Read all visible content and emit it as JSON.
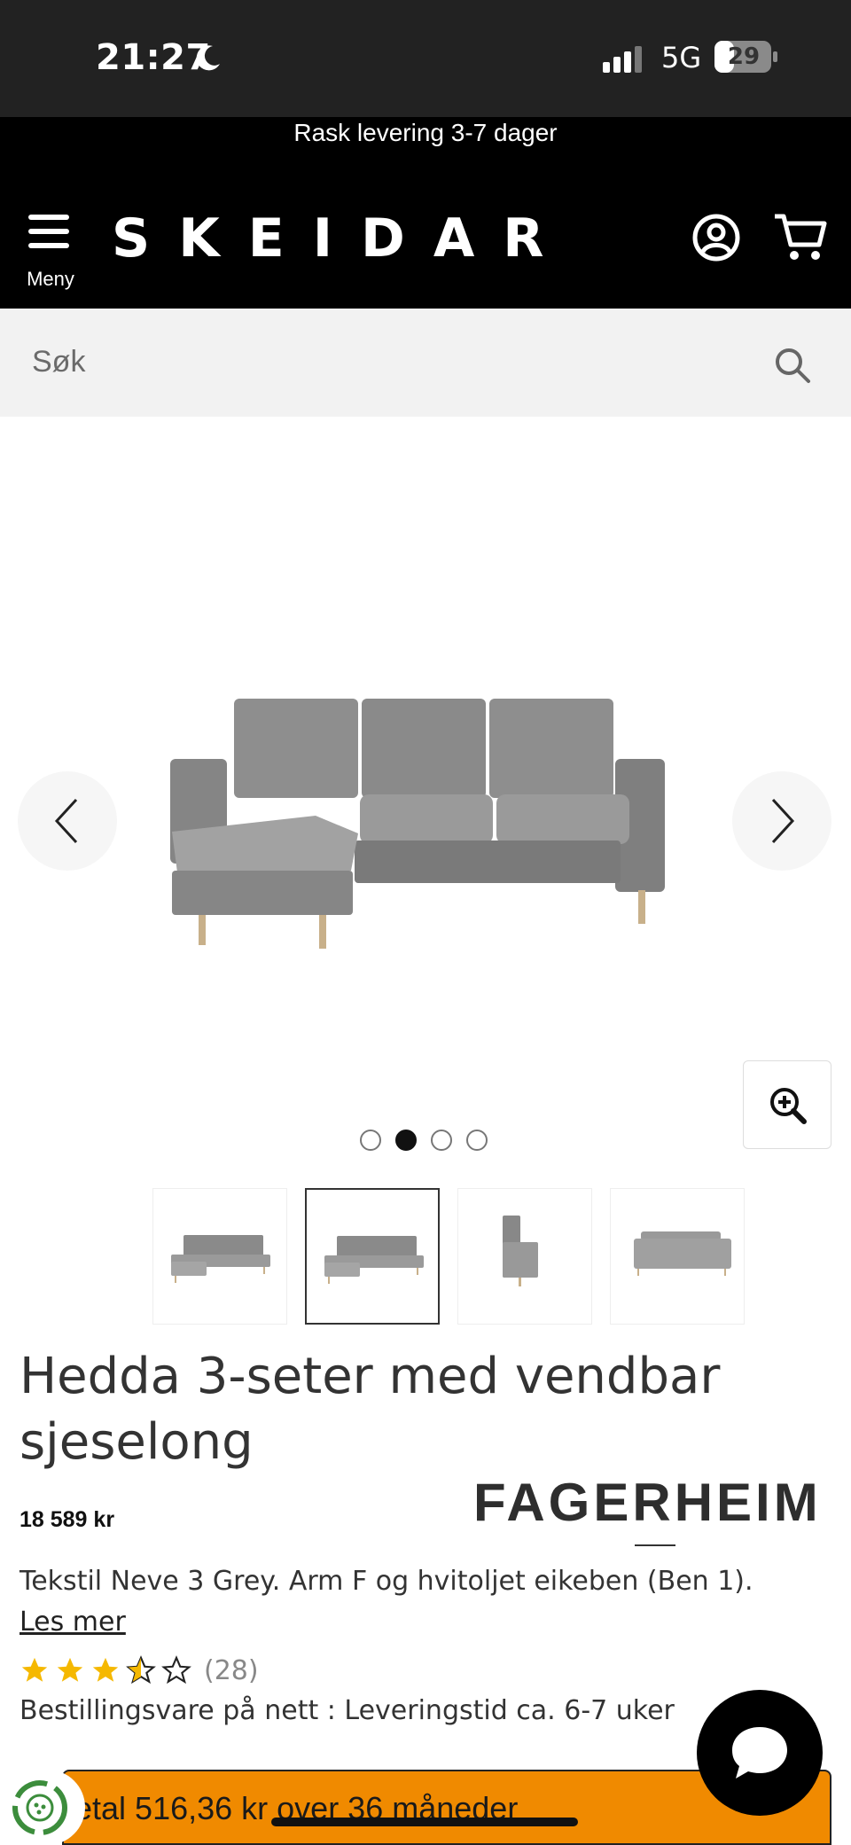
{
  "status_bar": {
    "time": "21:27",
    "network": "5G",
    "battery": "29"
  },
  "announcement": "Rask levering 3-7 dager",
  "header": {
    "menu_label": "Meny",
    "logo": "SKEIDAR",
    "account_icon": "user-circle-icon",
    "cart_icon": "shopping-cart-icon"
  },
  "search": {
    "placeholder": "Søk"
  },
  "gallery": {
    "dots": 4,
    "active_index": 1,
    "thumbnails": 4
  },
  "product": {
    "title": "Hedda 3-seter med vendbar sjeselong",
    "price": "18 589 kr",
    "brand": "FAGERHEIM",
    "variant": "Tekstil Neve 3 Grey. Arm F og hvitoljet eikeben (Ben 1).",
    "read_more": "Les mer",
    "rating_value": 3.5,
    "rating_count": "(28)",
    "delivery": "Bestillingsvare på nett : Leveringstid ca. 6-7 uker"
  },
  "finance": {
    "text": "etal 516,36 kr over 36 måneder"
  },
  "colors": {
    "accent": "#f08a00",
    "star": "#f5b800",
    "header_bg": "#000000"
  }
}
